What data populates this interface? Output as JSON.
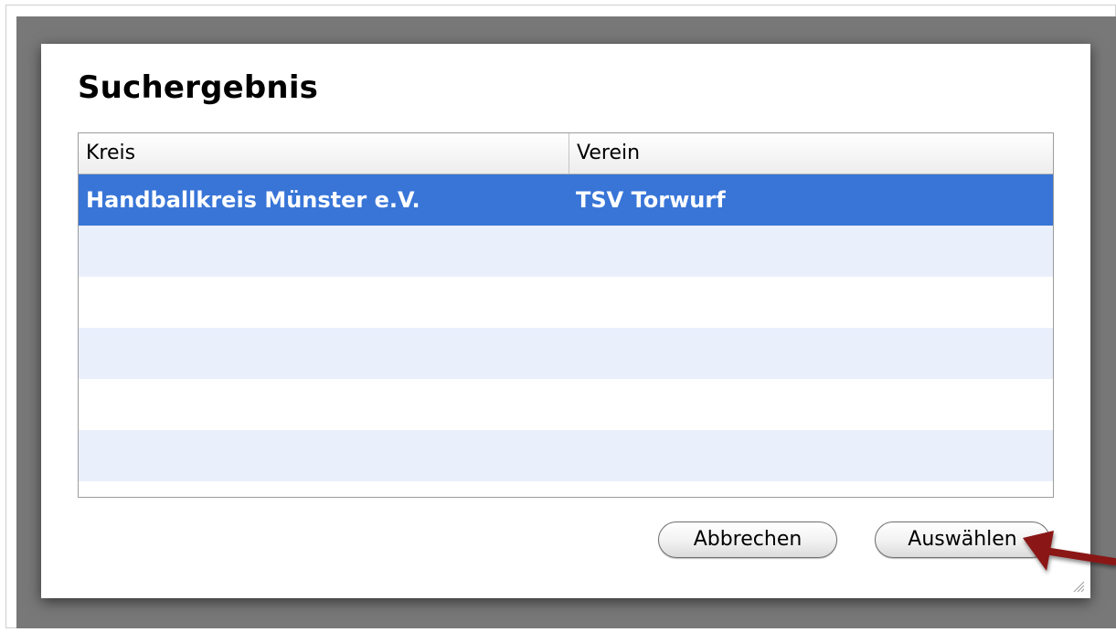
{
  "dialog": {
    "title": "Suchergebnis"
  },
  "table": {
    "columns": [
      "Kreis",
      "Verein"
    ],
    "rows": [
      {
        "kreis": "Handballkreis Münster e.V.",
        "verein": "TSV Torwurf",
        "selected": true
      }
    ],
    "empty_rows": 5
  },
  "buttons": {
    "cancel_label": "Abbrechen",
    "select_label": "Auswählen"
  },
  "colors": {
    "selection": "#3875d7",
    "stripe": "#e9effb",
    "backdrop": "#787878",
    "annotation_arrow": "#8a1414"
  },
  "icons": {
    "annotation": "red-arrow-icon",
    "resize": "resize-grip-icon"
  }
}
